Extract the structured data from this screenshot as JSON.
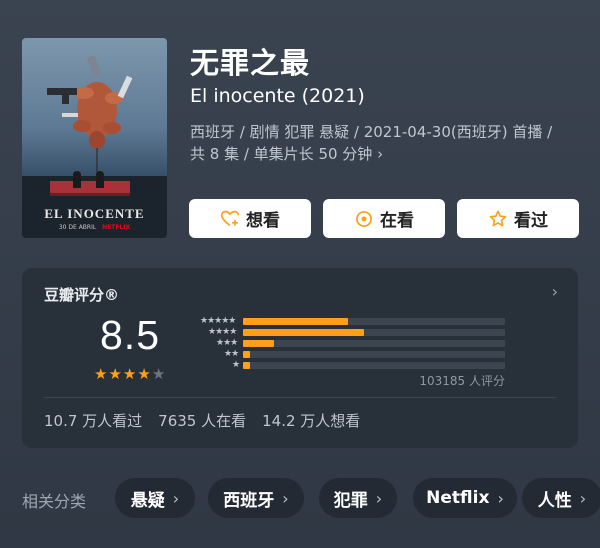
{
  "movie": {
    "title": "无罪之最",
    "original_title": "El inocente (2021)",
    "meta_line1": "西班牙 / 剧情 犯罪 悬疑 / 2021-04-30(西班牙) 首播 /",
    "meta_line2": "共 8 集 / 单集片长 50 分钟",
    "meta_chevron": "›",
    "poster_title": "EL INOCENTE",
    "poster_date": "30 DE ABRIL",
    "poster_brand": "NETFLIX"
  },
  "actions": {
    "want": "想看",
    "watching": "在看",
    "watched": "看过"
  },
  "rating": {
    "label": "豆瓣评分®",
    "chevron": "›",
    "score": "8.5",
    "stars": 4,
    "raters": "103185 人评分",
    "distribution": [
      {
        "stars": "★★★★★",
        "fraction": 0.4
      },
      {
        "stars": "★★★★",
        "fraction": 0.46
      },
      {
        "stars": "★★★",
        "fraction": 0.12
      },
      {
        "stars": "★★",
        "fraction": 0.025
      },
      {
        "stars": "★",
        "fraction": 0.025
      }
    ],
    "stats": {
      "watched": "10.7 万人看过",
      "watching": "7635 人在看",
      "want": "14.2 万人想看"
    }
  },
  "categories": {
    "label": "相关分类",
    "items": [
      "悬疑",
      "西班牙",
      "犯罪",
      "Netflix",
      "人性"
    ],
    "chevron": "›"
  },
  "colors": {
    "accent": "#ff9f1a",
    "card_bg": "#283039",
    "button_bg": "#ffffff"
  }
}
